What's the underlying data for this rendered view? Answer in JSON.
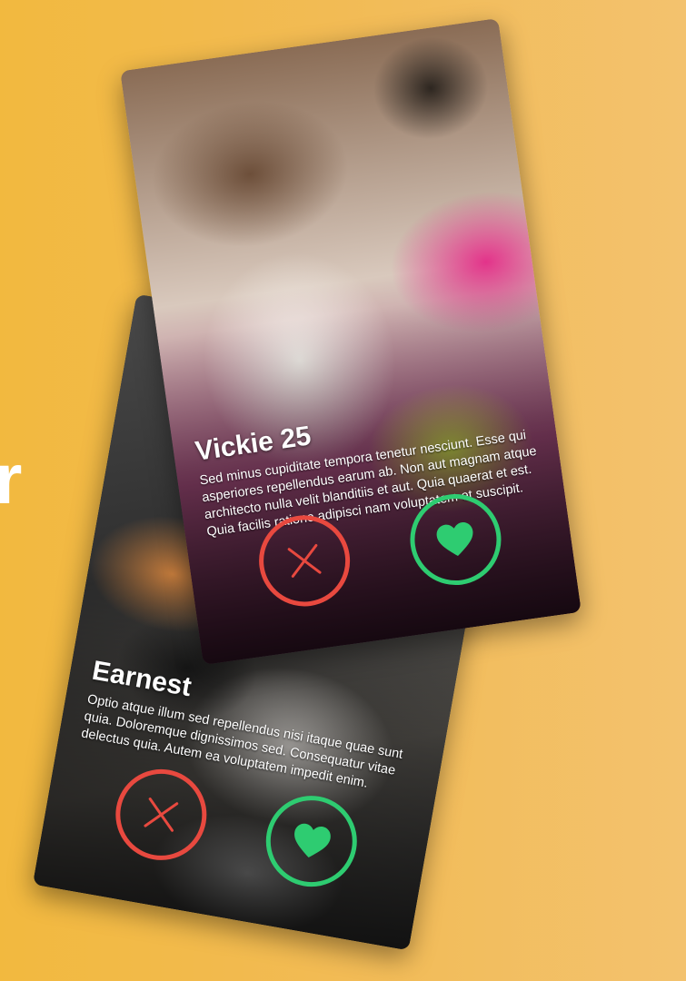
{
  "page": {
    "background_fragment": "r"
  },
  "colors": {
    "background": "#f2b93f",
    "nope": "#e8493f",
    "like": "#2ecc71",
    "text": "#ffffff"
  },
  "cards": [
    {
      "id": "front",
      "name_age": "Vickie 25",
      "bio": "Sed minus cupiditate tempora tenetur nesciunt. Esse qui asperiores repellendus earum ab. Non aut magnam atque architecto nulla velit blanditiis et aut. Quia quaerat et est. Quia facilis ratione adipisci nam voluptatem et suscipit.",
      "icons": {
        "nope": "close-icon",
        "like": "heart-icon"
      }
    },
    {
      "id": "back",
      "name_age": "Earnest",
      "bio": "Optio atque illum sed repellendus nisi itaque quae sunt quia. Doloremque dignissimos sed. Consequatur vitae delectus quia. Autem ea voluptatem impedit enim.",
      "icons": {
        "nope": "close-icon",
        "like": "heart-icon"
      }
    }
  ]
}
